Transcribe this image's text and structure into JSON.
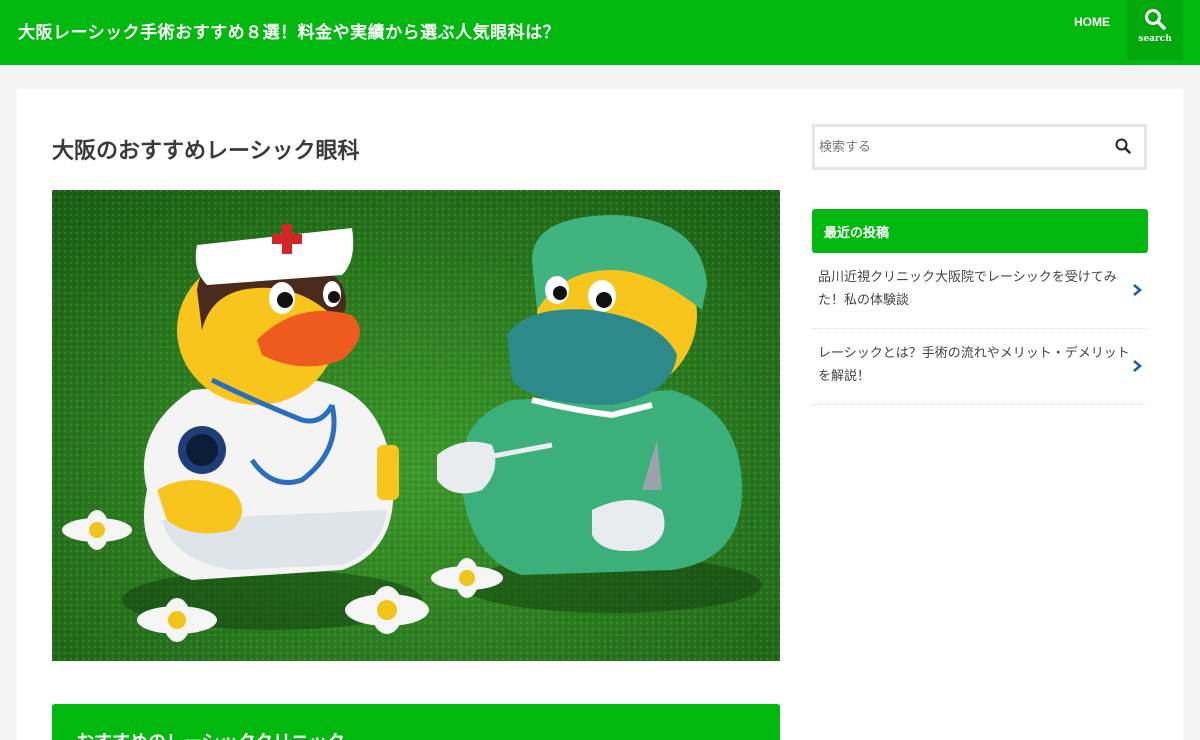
{
  "header": {
    "site_title": "大阪レーシック手術おすすめ８選！料金や実績から選ぶ人気眼科は？",
    "nav_home": "HOME",
    "search_label": "search",
    "bg_color": "#00b80e"
  },
  "main": {
    "page_title": "大阪のおすすめレーシック眼科",
    "section_heading": "おすすめのレーシッククリニック"
  },
  "sidebar": {
    "search_placeholder": "検索する",
    "recent_title": "最近の投稿",
    "posts": [
      {
        "title": "品川近視クリニック大阪院でレーシックを受けてみた！私の体験談"
      },
      {
        "title": "レーシックとは？手術の流れやメリット・デメリットを解説！"
      }
    ]
  },
  "icons": {
    "header_search": "search-icon",
    "sidebar_search": "search-icon",
    "post_arrow": "chevron-right-icon"
  }
}
